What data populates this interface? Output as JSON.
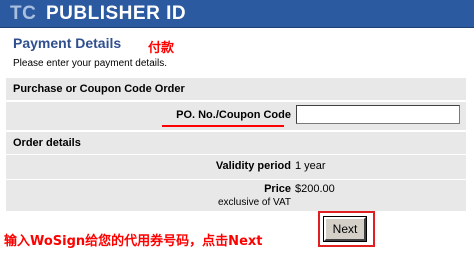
{
  "header": {
    "brand_prefix": "TC",
    "title": "PUBLISHER ID"
  },
  "page": {
    "section_title": "Payment Details",
    "annotation_payment": "付款",
    "instructions": "Please enter your payment details."
  },
  "purchase": {
    "heading": "Purchase or Coupon Code Order",
    "po_label": "PO. No./Coupon Code",
    "po_value": ""
  },
  "order": {
    "heading": "Order details",
    "validity_label": "Validity period",
    "validity_value": "1 year",
    "price_label": "Price",
    "price_sub": "exclusive of VAT",
    "price_value": "$200.00"
  },
  "footer": {
    "annotation_instruction": "输入WoSign给您的代用券号码，点击Next",
    "next_label": "Next"
  },
  "colors": {
    "banner": "#2c5aa0",
    "annotation": "#ff0000",
    "row_bg": "#e8e8e8"
  }
}
